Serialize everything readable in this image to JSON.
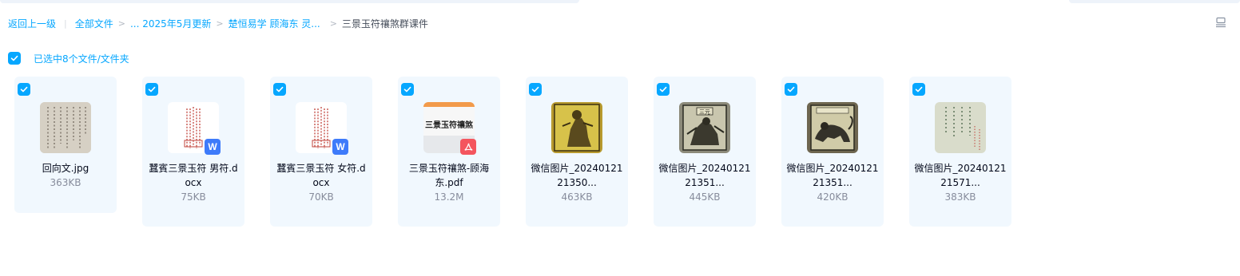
{
  "breadcrumb": {
    "back": "返回上一级",
    "all_files": "全部文件",
    "level1": "... 2025年5月更新",
    "level2": "楚恒易学 顾海东 灵...",
    "current": "三景玉符禳煞群课件"
  },
  "selection": {
    "text": "已选中8个文件/文件夹"
  },
  "files": [
    {
      "name": "回向文.jpg",
      "size": "363KB",
      "type": "image"
    },
    {
      "name": "蠶賓三景玉符 男符.docx",
      "size": "75KB",
      "type": "word"
    },
    {
      "name": "蠶賓三景玉符 女符.docx",
      "size": "70KB",
      "type": "word"
    },
    {
      "name": "三景玉符禳煞-顾海东.pdf",
      "size": "13.2M",
      "type": "pdf",
      "thumb_text": "三景玉符禳煞"
    },
    {
      "name": "微信图片_2024012121350...",
      "size": "463KB",
      "type": "image"
    },
    {
      "name": "微信图片_2024012121351...",
      "size": "445KB",
      "type": "image",
      "thumb_text": "三元"
    },
    {
      "name": "微信图片_2024012121351...",
      "size": "420KB",
      "type": "image"
    },
    {
      "name": "微信图片_2024012121571...",
      "size": "383KB",
      "type": "image"
    }
  ],
  "icons": {
    "checkbox": "checkbox-checked-icon",
    "view_toggle": "list-view-icon",
    "word_badge": "word-doc-icon",
    "pdf_badge": "pdf-icon"
  },
  "colors": {
    "accent": "#06a7ff",
    "card_bg": "#f1f8fe",
    "word_blue": "#3e7bfa",
    "pdf_red": "#f4555e"
  }
}
